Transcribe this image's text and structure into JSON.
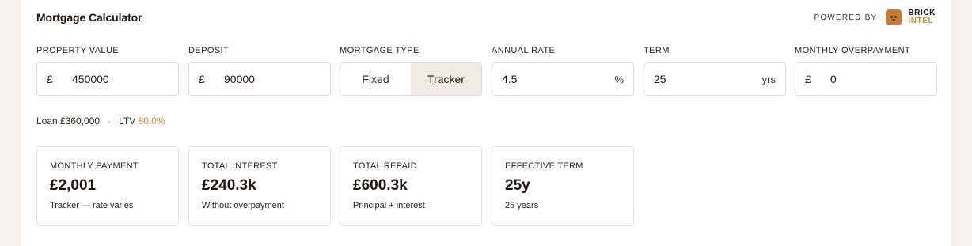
{
  "header": {
    "title": "Mortgage Calculator",
    "powered_by": "POWERED BY",
    "brand_line1": "BRICK",
    "brand_line2": "INTEL"
  },
  "fields": {
    "property_value": {
      "label": "PROPERTY VALUE",
      "prefix": "£",
      "value": "450000"
    },
    "deposit": {
      "label": "DEPOSIT",
      "prefix": "£",
      "value": "90000"
    },
    "mortgage_type": {
      "label": "MORTGAGE TYPE",
      "options": [
        "Fixed",
        "Tracker"
      ],
      "selected": "Tracker"
    },
    "annual_rate": {
      "label": "ANNUAL RATE",
      "value": "4.5",
      "suffix": "%"
    },
    "term": {
      "label": "TERM",
      "value": "25",
      "suffix": "yrs"
    },
    "monthly_overpayment": {
      "label": "MONTHLY OVERPAYMENT",
      "prefix": "£",
      "value": "0"
    }
  },
  "summary": {
    "loan": "Loan £360,000",
    "separator": "·",
    "ltv_label": "LTV",
    "ltv_value": "80.0%"
  },
  "stats": [
    {
      "label": "MONTHLY PAYMENT",
      "value": "£2,001",
      "sub": "Tracker — rate varies"
    },
    {
      "label": "TOTAL INTEREST",
      "value": "£240.3k",
      "sub": "Without overpayment"
    },
    {
      "label": "TOTAL REPAID",
      "value": "£600.3k",
      "sub": "Principal + interest"
    },
    {
      "label": "EFFECTIVE TERM",
      "value": "25y",
      "sub": "25 years"
    }
  ],
  "colors": {
    "accent": "#d08a37",
    "logo": "#c57a35",
    "toggle_active_bg": "#efebe5"
  }
}
